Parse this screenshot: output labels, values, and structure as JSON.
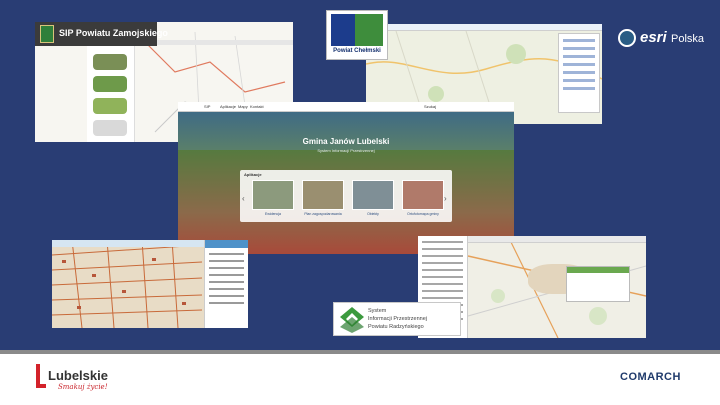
{
  "slide": {
    "background": "#293d74",
    "screenshots": {
      "zamojski": {
        "title": "SIP Powiatu Zamojskiego"
      },
      "chelmskie_logo": {
        "text": "Powiat Chełmski"
      },
      "janow": {
        "nav": [
          "SIP",
          "Aplikacje",
          "Mapy",
          "Kontakt",
          "Szukaj"
        ],
        "hero_title": "Gmina Janów Lubelski",
        "hero_subtitle": "System Informacji Przestrzennej",
        "apps_header": "Aplikacje",
        "apps": [
          "Ewidencja",
          "Plan zagospodarowania",
          "Obiekty",
          "Ortofotomapa gminy"
        ]
      },
      "radzyn_logo": {
        "line1": "System",
        "line2": "Informacji Przestrzennej",
        "line3": "Powiatu Radzyńskiego"
      }
    },
    "esri": {
      "word": "esri",
      "suffix": "Polska"
    }
  },
  "footer": {
    "lubelskie": {
      "word": "Lubelskie",
      "tagline": "Smakuj życie!"
    },
    "comarch": "COMARCH"
  }
}
